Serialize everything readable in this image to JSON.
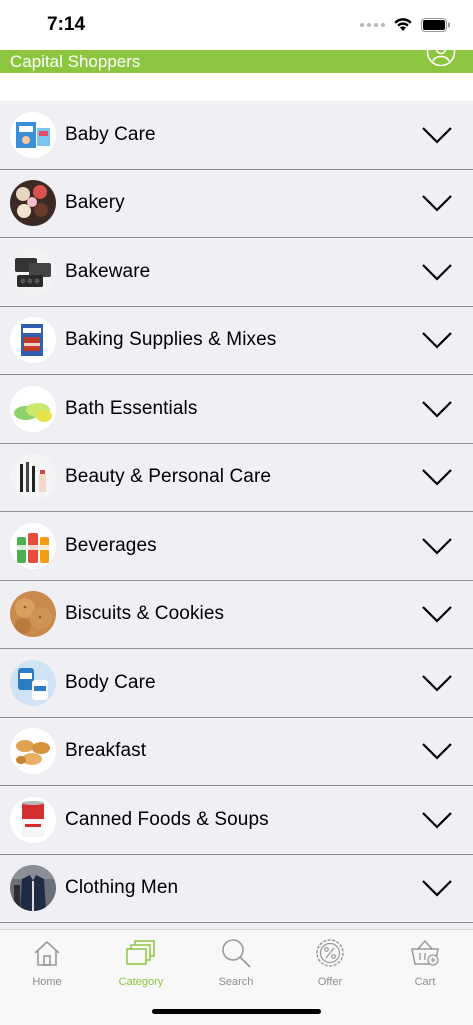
{
  "status_bar": {
    "time": "7:14"
  },
  "header": {
    "title": "Capital Shoppers"
  },
  "categories": [
    {
      "label": "Baby Care",
      "icon": "diapers-pack-icon"
    },
    {
      "label": "Bakery",
      "icon": "cupcakes-icon"
    },
    {
      "label": "Bakeware",
      "icon": "baking-pans-icon"
    },
    {
      "label": "Baking Supplies & Mixes",
      "icon": "cake-mix-box-icon"
    },
    {
      "label": "Bath Essentials",
      "icon": "soap-bars-icon"
    },
    {
      "label": "Beauty & Personal Care",
      "icon": "makeup-brushes-icon"
    },
    {
      "label": "Beverages",
      "icon": "juice-bottles-icon"
    },
    {
      "label": "Biscuits & Cookies",
      "icon": "cookies-icon"
    },
    {
      "label": "Body Care",
      "icon": "lotion-bottles-icon"
    },
    {
      "label": "Breakfast",
      "icon": "croissants-icon"
    },
    {
      "label": "Canned Foods & Soups",
      "icon": "soup-can-icon"
    },
    {
      "label": "Clothing Men",
      "icon": "mens-jacket-icon"
    }
  ],
  "tabbar": {
    "home": "Home",
    "category": "Category",
    "search": "Search",
    "offer": "Offer",
    "cart": "Cart"
  },
  "colors": {
    "accent": "#8cc63f",
    "list_bg": "#efeff4",
    "inactive": "#8e8e93"
  }
}
